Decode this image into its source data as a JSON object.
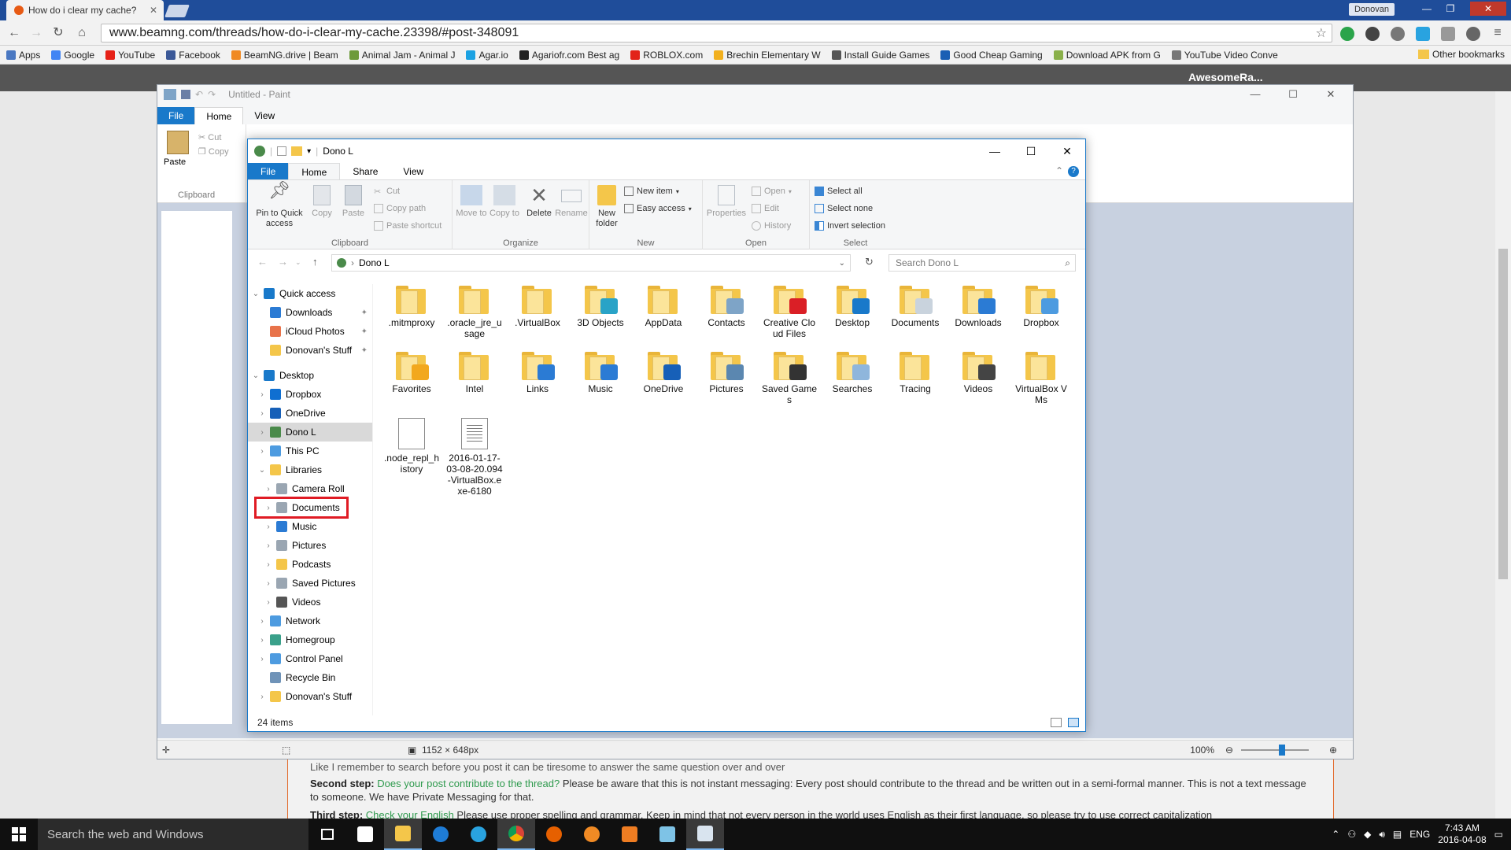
{
  "browser": {
    "tab_title": "How do i clear my cache?",
    "url": "www.beamng.com/threads/how-do-i-clear-my-cache.23398/#post-348091",
    "user_badge": "Donovan",
    "bookmarks": [
      {
        "label": "Apps",
        "color": "#4a78c2"
      },
      {
        "label": "Google",
        "color": "#4285f4"
      },
      {
        "label": "YouTube",
        "color": "#e62117"
      },
      {
        "label": "Facebook",
        "color": "#3b5998"
      },
      {
        "label": "BeamNG.drive | Beam",
        "color": "#f08a24"
      },
      {
        "label": "Animal Jam - Animal J",
        "color": "#6d9a3a"
      },
      {
        "label": "Agar.io",
        "color": "#1ba1e2"
      },
      {
        "label": "Agariofr.com Best ag",
        "color": "#222222"
      },
      {
        "label": "ROBLOX.com",
        "color": "#e2231a"
      },
      {
        "label": "Brechin Elementary W",
        "color": "#f2b01e"
      },
      {
        "label": "Install Guide Games",
        "color": "#555555"
      },
      {
        "label": "Good Cheap Gaming",
        "color": "#1a5fb4"
      },
      {
        "label": "Download APK from G",
        "color": "#8ab04a"
      },
      {
        "label": "YouTube Video Conve",
        "color": "#777777"
      }
    ],
    "other_bookmarks": "Other bookmarks"
  },
  "website": {
    "username": "AwesomeRa...",
    "second_step_title": "Second step:",
    "second_step_link": "Does your post contribute to the thread?",
    "second_step_text": "Please be aware that this is not instant messaging: Every post should contribute to the thread and be written out in a semi-formal manner. This is not a text message to someone. We have Private Messaging for that.",
    "third_step_title": "Third step:",
    "third_step_link": "Check your English",
    "third_step_text": "Please use proper spelling and grammar. Keep in mind that not every person in the world uses English as their first language, so please try to use correct capitalization",
    "top_line": "Like I remember to search before you post it can be tiresome to answer the same question over and over"
  },
  "paint": {
    "title": "Untitled - Paint",
    "tabs": [
      "File",
      "Home",
      "View"
    ],
    "paste_label": "Paste",
    "cut_label": "Cut",
    "copy_label": "Copy",
    "clipboard_label": "Clipboard",
    "dimensions": "1152 × 648px",
    "zoom": "100%"
  },
  "explorer": {
    "title": "Dono L",
    "tabs": [
      "File",
      "Home",
      "Share",
      "View"
    ],
    "ribbon": {
      "pin": "Pin to Quick access",
      "copy": "Copy",
      "paste": "Paste",
      "cut": "Cut",
      "copy_path": "Copy path",
      "paste_shortcut": "Paste shortcut",
      "clipboard": "Clipboard",
      "move_to": "Move to",
      "copy_to": "Copy to",
      "delete": "Delete",
      "rename": "Rename",
      "organize": "Organize",
      "new_folder": "New folder",
      "new_item": "New item",
      "easy_access": "Easy access",
      "new": "New",
      "properties": "Properties",
      "open": "Open",
      "edit": "Edit",
      "history": "History",
      "open_group": "Open",
      "select_all": "Select all",
      "select_none": "Select none",
      "invert_selection": "Invert selection",
      "select": "Select"
    },
    "address": "Dono L",
    "search_placeholder": "Search Dono L",
    "nav": [
      {
        "label": "Quick access",
        "chev": "⌄",
        "color": "#1979ca",
        "indent": 0
      },
      {
        "label": "Downloads",
        "chev": "",
        "color": "#2b7bd4",
        "indent": 1,
        "pin": true
      },
      {
        "label": "iCloud Photos",
        "chev": "",
        "color": "#e8734a",
        "indent": 1,
        "pin": true
      },
      {
        "label": "Donovan's Stuff",
        "chev": "",
        "color": "#f4c64a",
        "indent": 1,
        "pin": true
      },
      {
        "label": "Desktop",
        "chev": "⌄",
        "color": "#1979ca",
        "indent": 0,
        "gap": true
      },
      {
        "label": "Dropbox",
        "chev": "›",
        "color": "#0f6fd1",
        "indent": 1
      },
      {
        "label": "OneDrive",
        "chev": "›",
        "color": "#1760b8",
        "indent": 1
      },
      {
        "label": "Dono L",
        "chev": "›",
        "color": "#4a8a4a",
        "indent": 1,
        "selected": true
      },
      {
        "label": "This PC",
        "chev": "›",
        "color": "#4d9be0",
        "indent": 1
      },
      {
        "label": "Libraries",
        "chev": "⌄",
        "color": "#f4c64a",
        "indent": 1
      },
      {
        "label": "Camera Roll",
        "chev": "›",
        "color": "#9aa6b2",
        "indent": 2
      },
      {
        "label": "Documents",
        "chev": "›",
        "color": "#9aa6b2",
        "indent": 2,
        "highlight": true
      },
      {
        "label": "Music",
        "chev": "›",
        "color": "#2b7bd4",
        "indent": 2
      },
      {
        "label": "Pictures",
        "chev": "›",
        "color": "#9aa6b2",
        "indent": 2
      },
      {
        "label": "Podcasts",
        "chev": "›",
        "color": "#f4c64a",
        "indent": 2
      },
      {
        "label": "Saved Pictures",
        "chev": "›",
        "color": "#9aa6b2",
        "indent": 2
      },
      {
        "label": "Videos",
        "chev": "›",
        "color": "#555555",
        "indent": 2
      },
      {
        "label": "Network",
        "chev": "›",
        "color": "#4d9be0",
        "indent": 1
      },
      {
        "label": "Homegroup",
        "chev": "›",
        "color": "#3aa08a",
        "indent": 1
      },
      {
        "label": "Control Panel",
        "chev": "›",
        "color": "#4d9be0",
        "indent": 1
      },
      {
        "label": "Recycle Bin",
        "chev": "",
        "color": "#6f93b8",
        "indent": 1
      },
      {
        "label": "Donovan's Stuff",
        "chev": "›",
        "color": "#f4c64a",
        "indent": 1
      }
    ],
    "items": [
      {
        "label": ".mitmproxy",
        "kind": "folder",
        "overlay": ""
      },
      {
        "label": ".oracle_jre_usage",
        "kind": "folder",
        "overlay": ""
      },
      {
        "label": ".VirtualBox",
        "kind": "folder",
        "overlay": ""
      },
      {
        "label": "3D Objects",
        "kind": "folder",
        "overlay": "#29a3c7"
      },
      {
        "label": "AppData",
        "kind": "folder",
        "overlay": ""
      },
      {
        "label": "Contacts",
        "kind": "folder",
        "overlay": "#7ea4c7"
      },
      {
        "label": "Creative Cloud Files",
        "kind": "folder",
        "overlay": "#da1f26"
      },
      {
        "label": "Desktop",
        "kind": "folder",
        "overlay": "#1979ca"
      },
      {
        "label": "Documents",
        "kind": "folder",
        "overlay": "#c9d3dd"
      },
      {
        "label": "Downloads",
        "kind": "folder",
        "overlay": "#2b7bd4"
      },
      {
        "label": "Dropbox",
        "kind": "folder",
        "overlay": "#4d9be0"
      },
      {
        "label": "Favorites",
        "kind": "folder",
        "overlay": "#f2a81e"
      },
      {
        "label": "Intel",
        "kind": "folder",
        "overlay": ""
      },
      {
        "label": "Links",
        "kind": "folder",
        "overlay": "#2b7bd4"
      },
      {
        "label": "Music",
        "kind": "folder",
        "overlay": "#2b7bd4"
      },
      {
        "label": "OneDrive",
        "kind": "folder",
        "overlay": "#1760b8"
      },
      {
        "label": "Pictures",
        "kind": "folder",
        "overlay": "#5b87b0"
      },
      {
        "label": "Saved Games",
        "kind": "folder",
        "overlay": "#333333"
      },
      {
        "label": "Searches",
        "kind": "folder",
        "overlay": "#8fb6dc"
      },
      {
        "label": "Tracing",
        "kind": "folder",
        "overlay": ""
      },
      {
        "label": "Videos",
        "kind": "folder",
        "overlay": "#444444"
      },
      {
        "label": "VirtualBox VMs",
        "kind": "folder",
        "overlay": ""
      },
      {
        "label": ".node_repl_history",
        "kind": "file",
        "overlay": ""
      },
      {
        "label": "2016-01-17-03-08-20.094-VirtualBox.exe-6180",
        "kind": "textfile",
        "overlay": ""
      }
    ],
    "status": "24 items"
  },
  "taskbar": {
    "search_placeholder": "Search the web and Windows",
    "lang": "ENG",
    "time": "7:43 AM",
    "date": "2016-04-08"
  }
}
